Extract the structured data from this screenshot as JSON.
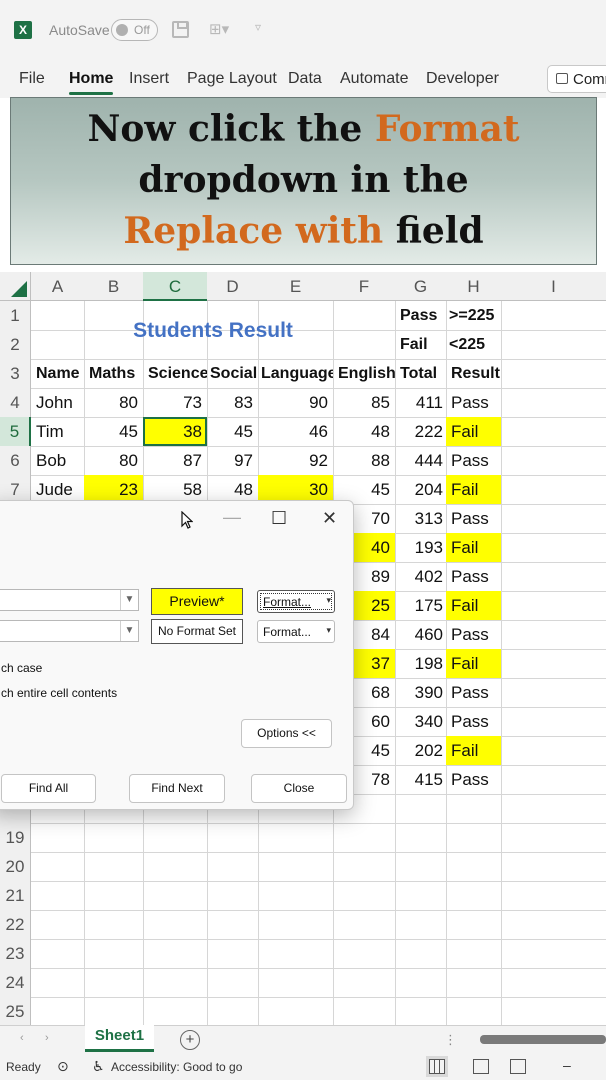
{
  "titlebar": {
    "logo": "X",
    "autosave_label": "AutoSave",
    "autosave_state": "Off",
    "icons": [
      "excel-logo-icon",
      "save-icon",
      "quick-access-icon",
      "customize-icon"
    ]
  },
  "ribbon": {
    "tabs": [
      "File",
      "Home",
      "Insert",
      "Page Layout",
      "Data",
      "Automate",
      "Developer"
    ],
    "active_tab": "Home",
    "comments_label": "Comments"
  },
  "banner": {
    "line1_a": "Now click the ",
    "line1_b": "Format",
    "line2": "dropdown in the",
    "line3_a": "Replace with",
    "line3_b": " field",
    "accent_color": "#d2691e"
  },
  "grid": {
    "columns": [
      "A",
      "B",
      "C",
      "D",
      "E",
      "F",
      "G",
      "H",
      "I"
    ],
    "selected_column": "C",
    "selected_row": "5",
    "row_numbers": [
      "1",
      "2",
      "3",
      "4",
      "5",
      "6",
      "7",
      "19",
      "20",
      "21",
      "22",
      "23",
      "24",
      "25"
    ],
    "title": "Students Result",
    "legend": [
      {
        "label": "Pass",
        "value": ">=225"
      },
      {
        "label": "Fail",
        "value": "<225"
      }
    ],
    "headers": [
      "Name",
      "Maths",
      "Science",
      "Social",
      "Language",
      "English",
      "Total",
      "Result"
    ],
    "rows": [
      {
        "name": "John",
        "maths": "80",
        "science": "73",
        "social": "83",
        "language": "90",
        "english": "85",
        "total": "411",
        "result": "Pass"
      },
      {
        "name": "Tim",
        "maths": "45",
        "science": "38",
        "social": "45",
        "language": "46",
        "english": "48",
        "total": "222",
        "result": "Fail"
      },
      {
        "name": "Bob",
        "maths": "80",
        "science": "87",
        "social": "97",
        "language": "92",
        "english": "88",
        "total": "444",
        "result": "Pass"
      },
      {
        "name": "Jude",
        "maths": "23",
        "science": "58",
        "social": "48",
        "language": "30",
        "english": "45",
        "total": "204",
        "result": "Fail"
      }
    ],
    "visible_right": [
      {
        "english": "70",
        "total": "313",
        "result": "Pass"
      },
      {
        "english": "40",
        "total": "193",
        "result": "Fail"
      },
      {
        "english": "89",
        "total": "402",
        "result": "Pass"
      },
      {
        "english": "25",
        "total": "175",
        "result": "Fail"
      },
      {
        "english": "84",
        "total": "460",
        "result": "Pass"
      },
      {
        "english": "37",
        "total": "198",
        "result": "Fail"
      },
      {
        "english": "68",
        "total": "390",
        "result": "Pass"
      },
      {
        "english": "60",
        "total": "340",
        "result": "Pass"
      },
      {
        "english": "45",
        "total": "202",
        "result": "Fail"
      },
      {
        "english": "78",
        "total": "415",
        "result": "Pass"
      }
    ],
    "highlight_color": "#ffff00",
    "title_color": "#4472c4"
  },
  "dialog": {
    "minimize": "—",
    "maximize": "☐",
    "close_x": "✕",
    "preview_label": "Preview*",
    "no_format_label": "No Format Set",
    "format_button_1": "Format...",
    "format_button_2": "Format...",
    "match_case": "ch case",
    "match_entire": "ch entire cell contents",
    "options_button": "Options <<",
    "find_all": "Find All",
    "find_next": "Find Next",
    "close_button": "Close"
  },
  "sheetbar": {
    "sheet_name": "Sheet1",
    "add_label": "+",
    "nav_prev": "‹",
    "nav_next": "›"
  },
  "statusbar": {
    "ready": "Ready",
    "accessibility": "Accessibility: Good to go",
    "zoom_minus": "–"
  }
}
